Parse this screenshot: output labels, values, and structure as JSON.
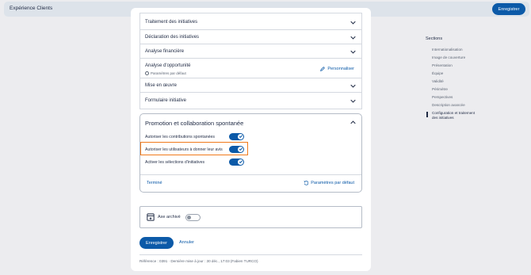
{
  "header": {
    "title": "Expérience Clients",
    "save_label": "Enregistrer"
  },
  "sections": [
    {
      "label": "Traitement des initiatives"
    },
    {
      "label": "Déclaration des initiatives"
    },
    {
      "label": "Analyse financière"
    },
    {
      "label": "Analyse d'opportunité",
      "status": "Paramètres par défaut",
      "action": "Personnaliser"
    },
    {
      "label": "Mise en œuvre"
    },
    {
      "label": "Formulaire initiative"
    }
  ],
  "promo": {
    "title": "Promotion et collaboration spontanée",
    "toggles": [
      {
        "label": "Autoriser les contributions spontanées",
        "state": "on"
      },
      {
        "label": "Autoriser les utilisateurs à donner leur avis",
        "state": "on"
      },
      {
        "label": "Activer les sélections d'initiatives",
        "state": "on"
      }
    ],
    "done_label": "Terminé",
    "reset_label": "Paramètres par défaut"
  },
  "archive": {
    "label": "Axe archivé",
    "state": "off"
  },
  "form": {
    "save_label": "Enregistrer",
    "cancel_label": "Annuler"
  },
  "footer": {
    "reference": "Référence : 0391  ·  Dernière mise à jour : 30 déc., 17:03 (Fabien TURCO)"
  },
  "toc": {
    "title": "Sections",
    "items": [
      "Internationalisation",
      "Image de couverture",
      "Présentation",
      "Équipe",
      "Validité",
      "Périmètre",
      "Perspectives",
      "Description avancée",
      "Configuration et traitement des initiatives"
    ]
  },
  "colors": {
    "accent": "#0c5aa8",
    "highlight": "#f07a1c",
    "background": "#ececef"
  }
}
